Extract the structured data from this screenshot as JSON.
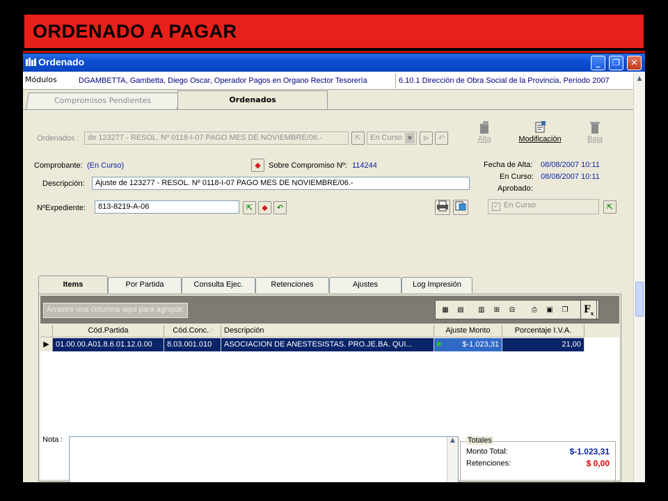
{
  "slide": {
    "title": "ORDENADO A PAGAR"
  },
  "window": {
    "title": "Ordenado",
    "minimize": "_",
    "maximize": "❐",
    "close": "✕"
  },
  "modbar": {
    "label": "Módulos",
    "user": "DGAMBETTA, Gambetta, Diego Oscar, Operador Pagos en Organo Rector Tesorería",
    "org": "6.10.1 Dirección de Obra Social de la Provincia, Período 2007"
  },
  "tabs": [
    {
      "label": "Compromisos Pendientes"
    },
    {
      "label": "Ordenados"
    }
  ],
  "header": {
    "ordenados_label": "Ordenados :",
    "ordenados_value": "de  123277 - RESOL. Nº 0118-I-07 PAGO MES DE NOVIEMBRE/06.-",
    "estado_value": "En Curso",
    "alta_label": "Alta",
    "modificacion_label": "Modificación",
    "baja_label": "Baja",
    "comprobante_label": "Comprobante:",
    "comprobante_value": "(En Curso)",
    "sobre_label": "Sobre Compromiso Nº:",
    "sobre_value": "114244",
    "fecha_alta_label": "Fecha de Alta:",
    "fecha_alta_value": "08/08/2007 10:11",
    "en_curso_label": "En Curso:",
    "en_curso_value": "08/08/2007 10:11",
    "aprobado_label": "Aprobado:",
    "descripcion_label": "Descripción:",
    "descripcion_value": "Ajuste de  123277 - RESOL. Nº 0118-I-07 PAGO MES DE NOVIEMBRE/06.-",
    "expediente_label": "NºExpediente:",
    "expediente_value": "813-8219-A-06",
    "check_label": "En Curso"
  },
  "inner_tabs": [
    {
      "label": "Items"
    },
    {
      "label": "Por Partida"
    },
    {
      "label": "Consulta Ejec."
    },
    {
      "label": "Retenciones"
    },
    {
      "label": "Ajustes"
    },
    {
      "label": "Log Impresión"
    }
  ],
  "grid": {
    "group_hint": "Arrastre una columna aquí para agrupar.",
    "f_button": "F",
    "columns": [
      {
        "label": "Cód.Partida"
      },
      {
        "label": "Cód.Conc."
      },
      {
        "label": "Descripción"
      },
      {
        "label": "Ajuste Monto"
      },
      {
        "label": "Porcentaje  I.V.A."
      }
    ],
    "rows": [
      {
        "cod_partida": "01.00.00.A01.8.6.01.12.0.00",
        "cod_conc": "8.03.001.010",
        "descripcion": "ASOCIACION DE ANESTESISTAS. PRO.JE.BA. QUI...",
        "ajuste_monto": "$-1.023,31",
        "porcentaje_iva": "21,00"
      }
    ]
  },
  "nota": {
    "label": "Nota :"
  },
  "totales": {
    "title": "Totales",
    "monto_label": "Monto Total:",
    "monto_value": "$-1.023,31",
    "retenciones_label": "Retenciones:",
    "retenciones_value": "$ 0,00"
  },
  "colors": {
    "slide_banner": "#e8201c",
    "titlebar": "#0d4fd1",
    "selection": "#0a246a",
    "link_blue": "#0a24a8",
    "monto_blue": "#0a24a8",
    "retenciones_red": "#e00000"
  }
}
